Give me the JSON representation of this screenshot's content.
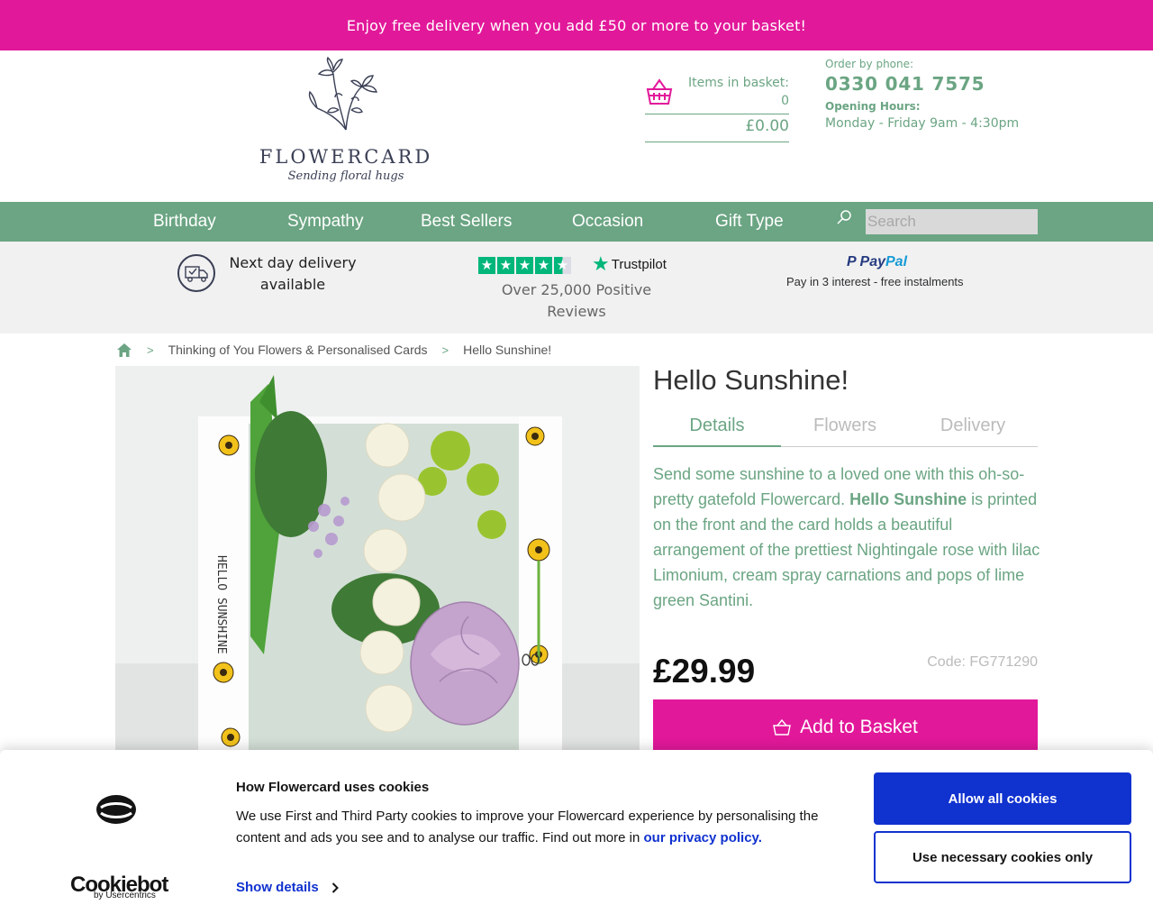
{
  "promo": {
    "text": "Enjoy free delivery when you add £50 or more to your basket!"
  },
  "header": {
    "logo": {
      "word": "FLOWERCARD",
      "tagline": "Sending floral hugs"
    },
    "basket": {
      "label": "Items in basket:",
      "count": "0",
      "total": "£0.00"
    },
    "contact": {
      "order_label": "Order by phone:",
      "phone": "0330 041 7575",
      "hours_label": "Opening Hours:",
      "hours": "Monday - Friday 9am - 4:30pm"
    }
  },
  "nav": {
    "items": [
      {
        "label": "Birthday"
      },
      {
        "label": "Sympathy"
      },
      {
        "label": "Best Sellers"
      },
      {
        "label": "Occasion"
      },
      {
        "label": "Gift Type"
      }
    ],
    "search_placeholder": "Search"
  },
  "trust": {
    "delivery": "Next day delivery available",
    "trustpilot_brand": "Trustpilot",
    "trustpilot_rating": 4.5,
    "reviews": "Over 25,000 Positive Reviews",
    "paypal_pay": "Pay",
    "paypal_pal": "Pal",
    "paypal_text": "Pay in 3 interest - free instalments"
  },
  "breadcrumb": {
    "items": [
      "Thinking of You Flowers & Personalised Cards",
      "Hello Sunshine!"
    ]
  },
  "product": {
    "image_caption": "HELLO SUNSHINE",
    "title": "Hello Sunshine!",
    "tabs": [
      {
        "label": "Details"
      },
      {
        "label": "Flowers"
      },
      {
        "label": "Delivery"
      }
    ],
    "description_before": "Send some sunshine to a loved one with this oh-so-pretty gatefold Flowercard. ",
    "description_bold": "Hello Sunshine",
    "description_after": " is printed on the front and the card holds a beautiful arrangement of the prettiest Nightingale rose with lilac Limonium, cream spray carnations and pops of lime green Santini.",
    "price": "£29.99",
    "code": "Code: FG771290",
    "add_button": "Add to Basket"
  },
  "cookie": {
    "brand": "Cookiebot",
    "brand_sub": "by Usercentrics",
    "title": "How Flowercard uses cookies",
    "body": "We use First and Third Party cookies to improve your Flowercard experience by personalising the content and ads you see and to analyse our traffic. Find out more in ",
    "link": "our privacy policy.",
    "show_details": "Show details",
    "allow_all": "Allow all cookies",
    "necessary_only": "Use necessary cookies only"
  },
  "colors": {
    "brand_pink": "#e2189a",
    "brand_green": "#6ba583",
    "cookie_blue": "#1032cf"
  }
}
